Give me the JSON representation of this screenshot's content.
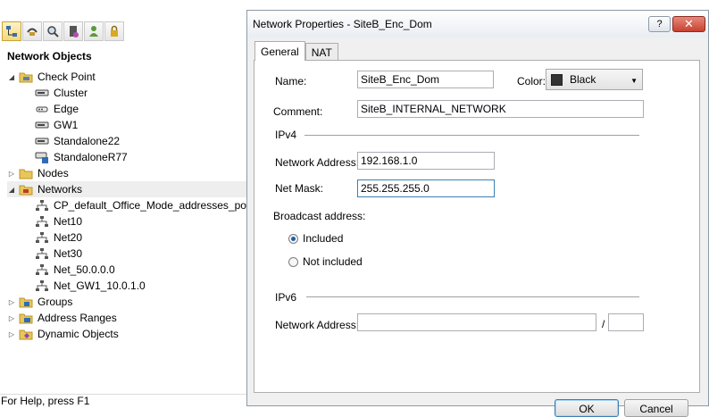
{
  "tree": {
    "title": "Network Objects",
    "items": [
      {
        "label": "Check Point"
      },
      {
        "label": "Cluster"
      },
      {
        "label": "Edge"
      },
      {
        "label": "GW1"
      },
      {
        "label": "Standalone22"
      },
      {
        "label": "StandaloneR77"
      },
      {
        "label": "Nodes"
      },
      {
        "label": "Networks"
      },
      {
        "label": "CP_default_Office_Mode_addresses_poo"
      },
      {
        "label": "Net10"
      },
      {
        "label": "Net20"
      },
      {
        "label": "Net30"
      },
      {
        "label": "Net_50.0.0.0"
      },
      {
        "label": "Net_GW1_10.0.1.0"
      },
      {
        "label": "Groups"
      },
      {
        "label": "Address Ranges"
      },
      {
        "label": "Dynamic Objects"
      }
    ]
  },
  "status_bar": "For Help, press F1",
  "dialog": {
    "title": "Network Properties - SiteB_Enc_Dom",
    "help_label": "?",
    "close_label": "✕",
    "tabs": [
      {
        "label": "General"
      },
      {
        "label": "NAT"
      }
    ],
    "name_label": "Name:",
    "name_value": "SiteB_Enc_Dom",
    "color_label": "Color:",
    "color_value": "Black",
    "color_swatch_hex": "#333333",
    "comment_label": "Comment:",
    "comment_value": "SiteB_INTERNAL_NETWORK",
    "ipv4_label": "IPv4",
    "network_address_label": "Network Address:",
    "network_address_value": "192.168.1.0",
    "net_mask_label": "Net Mask:",
    "net_mask_value": "255.255.255.0",
    "broadcast_label": "Broadcast address:",
    "broadcast_included_label": "Included",
    "broadcast_not_included_label": "Not included",
    "broadcast_selected": "Included",
    "ipv6_label": "IPv6",
    "ipv6_network_address_label": "Network Address:",
    "ipv6_network_address_value": "",
    "ipv6_prefix_separator": "/",
    "ipv6_prefix_value": "",
    "ok_label": "OK",
    "cancel_label": "Cancel"
  }
}
